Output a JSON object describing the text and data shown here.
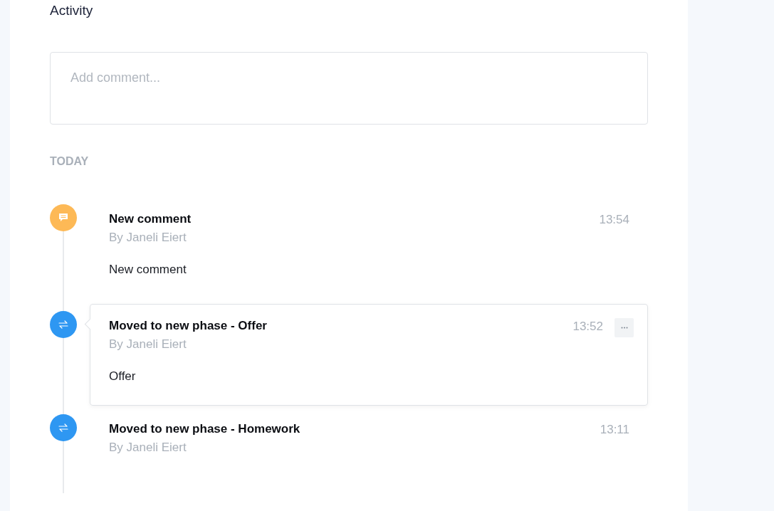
{
  "title": "Activity",
  "comment_field": {
    "placeholder": "Add comment..."
  },
  "section_label": "TODAY",
  "entries": [
    {
      "kind": "comment",
      "title": "New comment",
      "author": "By Janeli Eiert",
      "time": "13:54",
      "body": "New comment",
      "highlighted": false
    },
    {
      "kind": "phase",
      "title": "Moved to new phase - Offer",
      "author": "By Janeli Eiert",
      "time": "13:52",
      "body": "Offer",
      "highlighted": true
    },
    {
      "kind": "phase",
      "title": "Moved to new phase - Homework",
      "author": "By Janeli Eiert",
      "time": "13:11",
      "highlighted": false
    }
  ]
}
